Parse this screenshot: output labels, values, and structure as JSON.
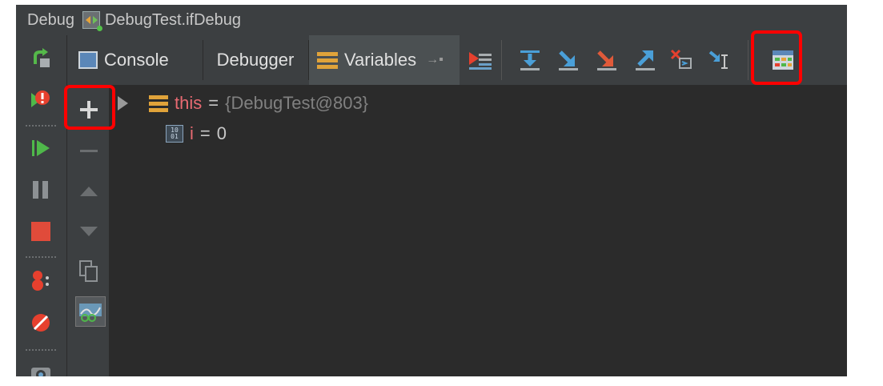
{
  "title": {
    "panel": "Debug",
    "config": "DebugTest.ifDebug"
  },
  "tabs": [
    {
      "label": "Console"
    },
    {
      "label": "Debugger"
    },
    {
      "label": "Variables"
    }
  ],
  "variables": [
    {
      "name": "this",
      "value": "{DebugTest@803}"
    },
    {
      "name": "i",
      "value": "0"
    }
  ],
  "icons": {
    "rerun": "rerun-icon",
    "view_breakpoints": "view-breakpoints-icon",
    "resume": "resume-icon",
    "pause": "pause-icon",
    "stop": "stop-icon",
    "mute_breakpoints": "mute-breakpoints-icon",
    "get_thread_dump": "thread-dump-icon",
    "camera": "camera-icon",
    "new_watch": "plus-icon",
    "remove_watch": "minus-icon",
    "up": "up-icon",
    "down": "down-icon",
    "copy": "copy-icon",
    "show_watches": "watches-icon",
    "evaluate": "evaluate-expression-icon"
  },
  "colors": {
    "highlight": "#ff0000",
    "background": "#2b2b2b",
    "panel": "#3c3f41",
    "var_name": "#e86a72"
  }
}
